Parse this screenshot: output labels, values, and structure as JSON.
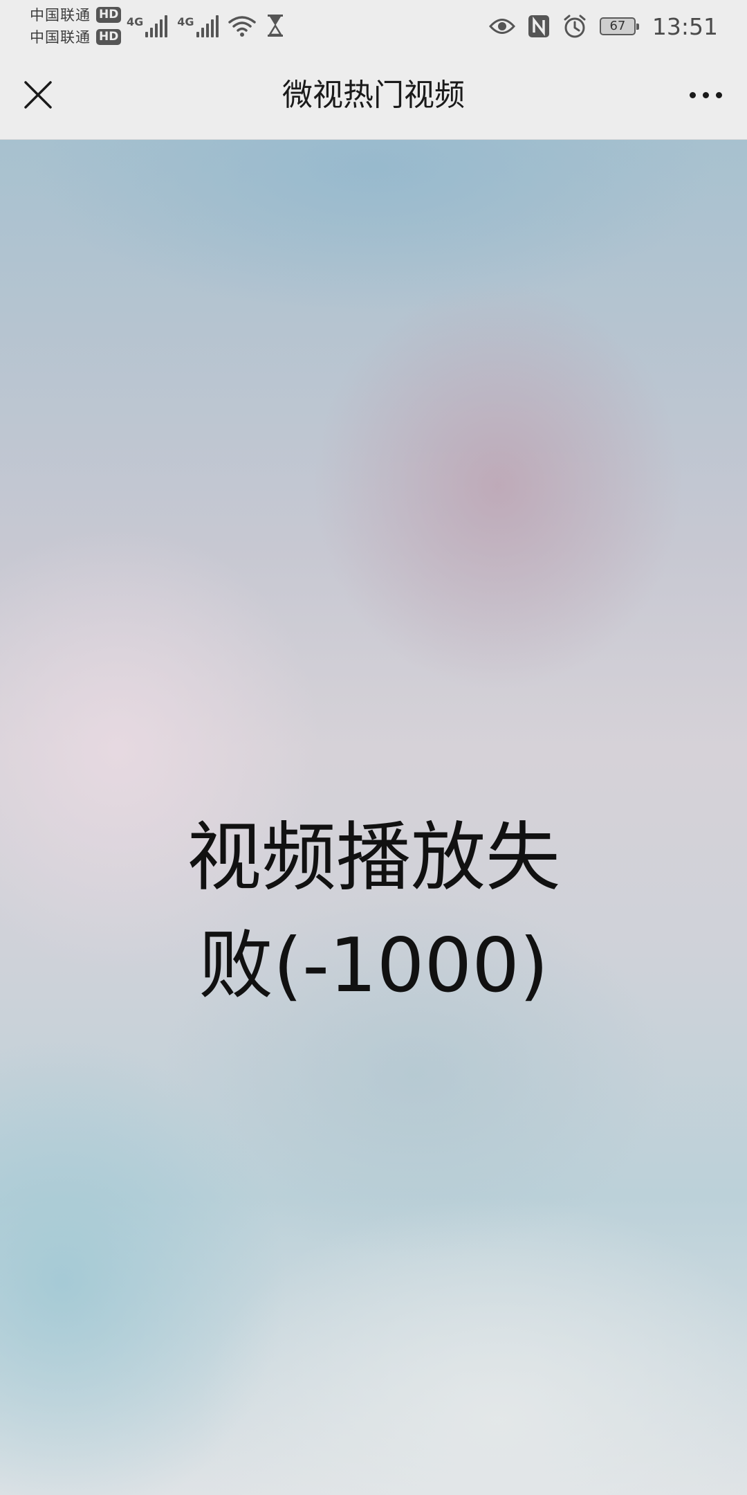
{
  "status_bar": {
    "carrier_1": "中国联通",
    "carrier_1_badge": "HD",
    "carrier_2": "中国联通",
    "carrier_2_badge": "HD",
    "network_1": "4G",
    "network_2": "4G",
    "battery_level": "67",
    "time": "13:51",
    "icons": [
      "signal-icon",
      "wifi-icon",
      "hourglass-icon",
      "eye-icon",
      "nfc-icon",
      "alarm-icon",
      "battery-icon"
    ]
  },
  "nav_bar": {
    "title": "微视热门视频",
    "close_icon": "close-icon",
    "more_icon": "more-icon"
  },
  "video": {
    "error_line_1": "视频播放失",
    "error_line_2": "败(-1000)"
  }
}
